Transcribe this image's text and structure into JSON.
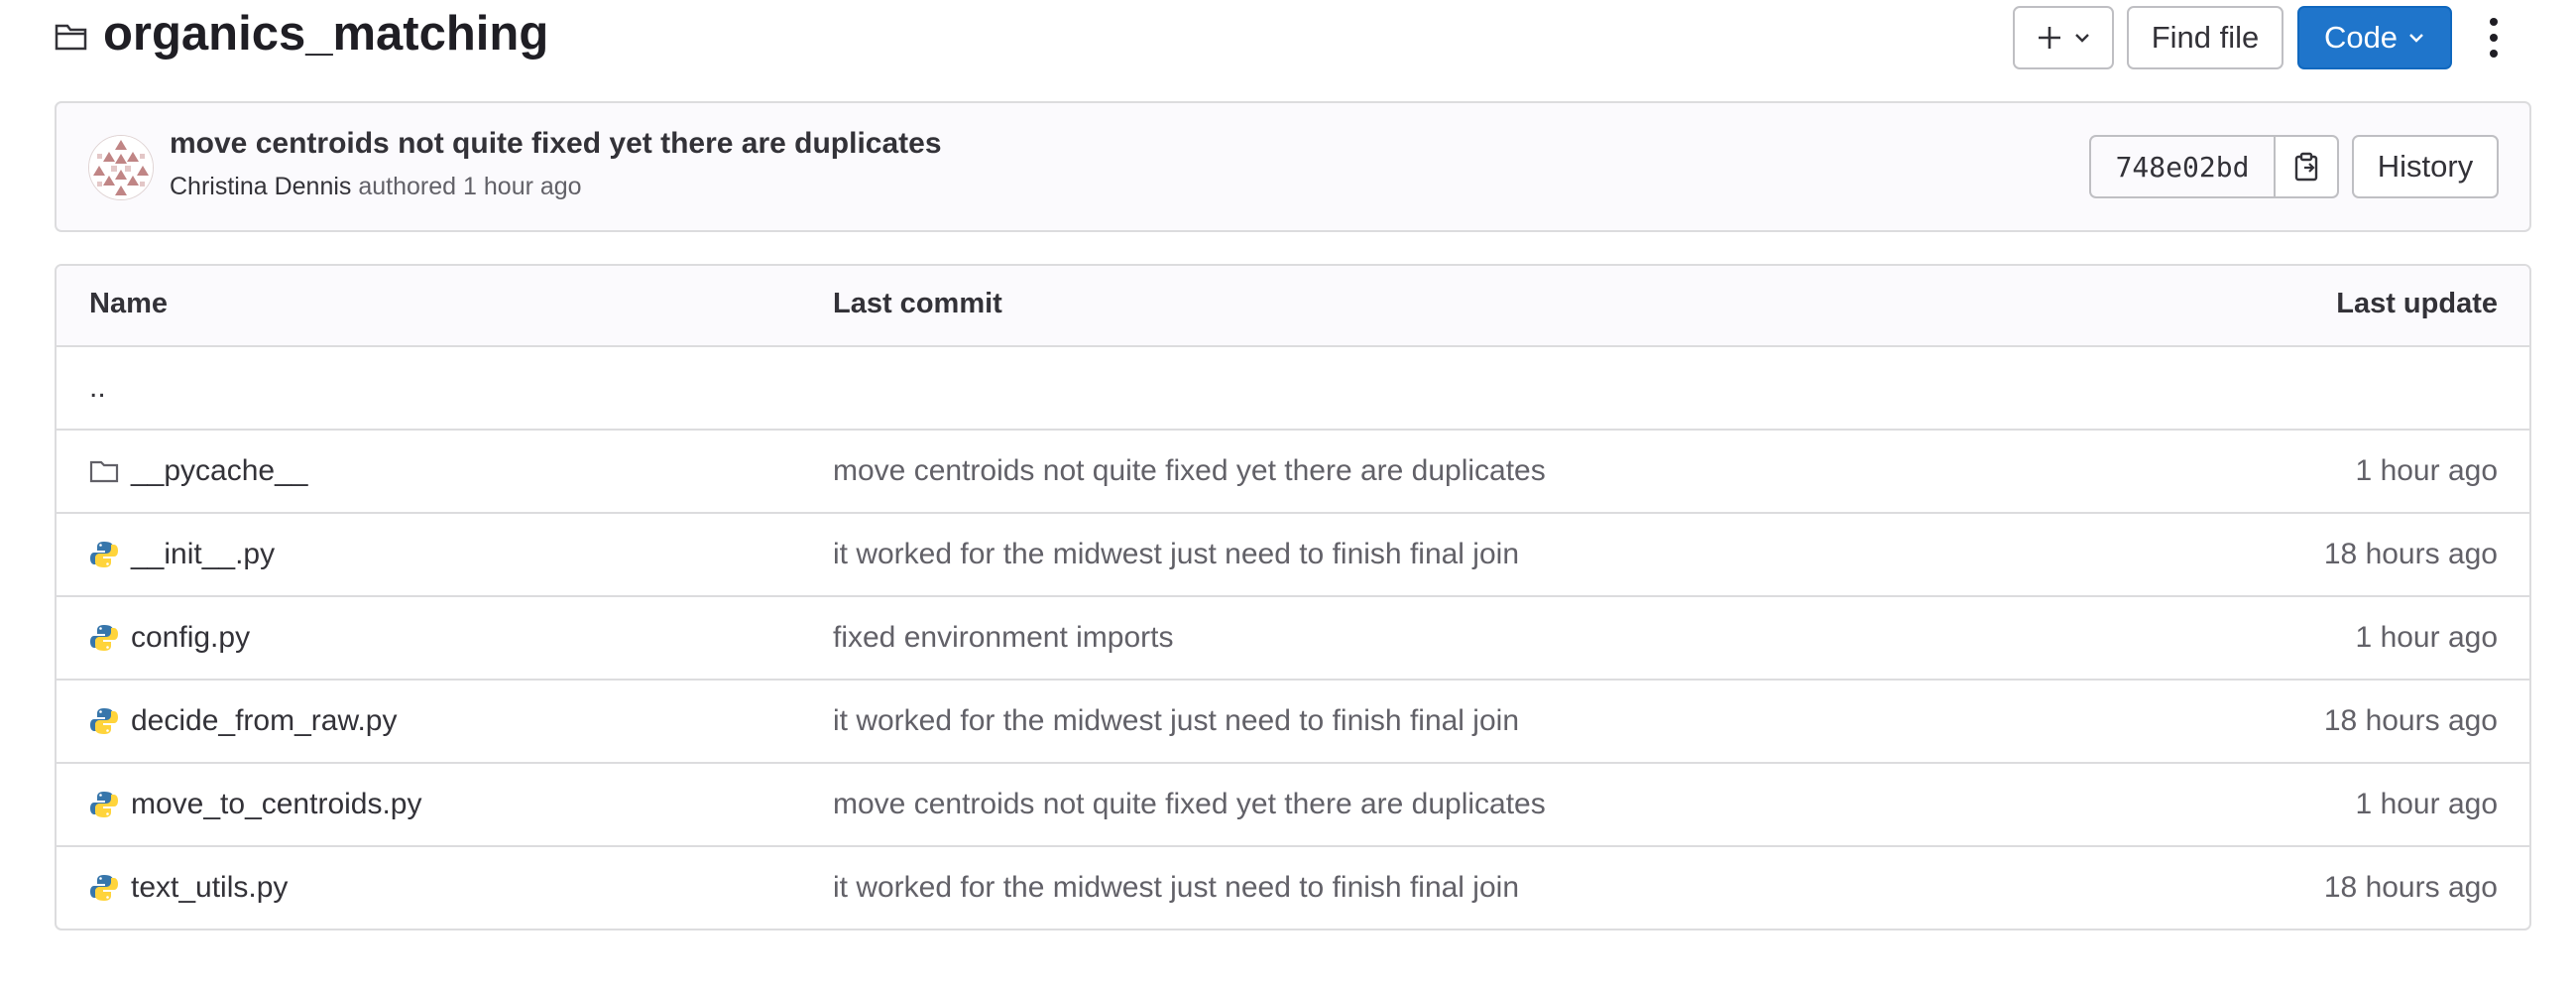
{
  "header": {
    "title": "organics_matching",
    "folder_icon": "folder-open-icon",
    "add_button_icon": "plus-icon",
    "find_file_label": "Find file",
    "code_label": "Code",
    "more_icon": "kebab-icon"
  },
  "last_commit": {
    "title": "move centroids not quite fixed yet there are duplicates",
    "author": "Christina Dennis",
    "authored_label": "authored",
    "time": "1 hour ago",
    "sha": "748e02bd",
    "history_label": "History"
  },
  "table": {
    "headers": {
      "name": "Name",
      "last_commit": "Last commit",
      "last_update": "Last update"
    },
    "parent": "..",
    "rows": [
      {
        "name": "__pycache__",
        "icon": "folder-icon",
        "commit": "move centroids not quite fixed yet there are duplicates",
        "updated": "1 hour ago"
      },
      {
        "name": "__init__.py",
        "icon": "python-file-icon",
        "commit": "it worked for the midwest just need to finish final join",
        "updated": "18 hours ago"
      },
      {
        "name": "config.py",
        "icon": "python-file-icon",
        "commit": "fixed environment imports",
        "updated": "1 hour ago"
      },
      {
        "name": "decide_from_raw.py",
        "icon": "python-file-icon",
        "commit": "it worked for the midwest just need to finish final join",
        "updated": "18 hours ago"
      },
      {
        "name": "move_to_centroids.py",
        "icon": "python-file-icon",
        "commit": "move centroids not quite fixed yet there are duplicates",
        "updated": "1 hour ago"
      },
      {
        "name": "text_utils.py",
        "icon": "python-file-icon",
        "commit": "it worked for the midwest just need to finish final join",
        "updated": "18 hours ago"
      }
    ]
  },
  "colors": {
    "primary": "#1f75cb",
    "border": "#dcdcde",
    "python_blue": "#3776ab",
    "python_yellow": "#ffd43b"
  }
}
